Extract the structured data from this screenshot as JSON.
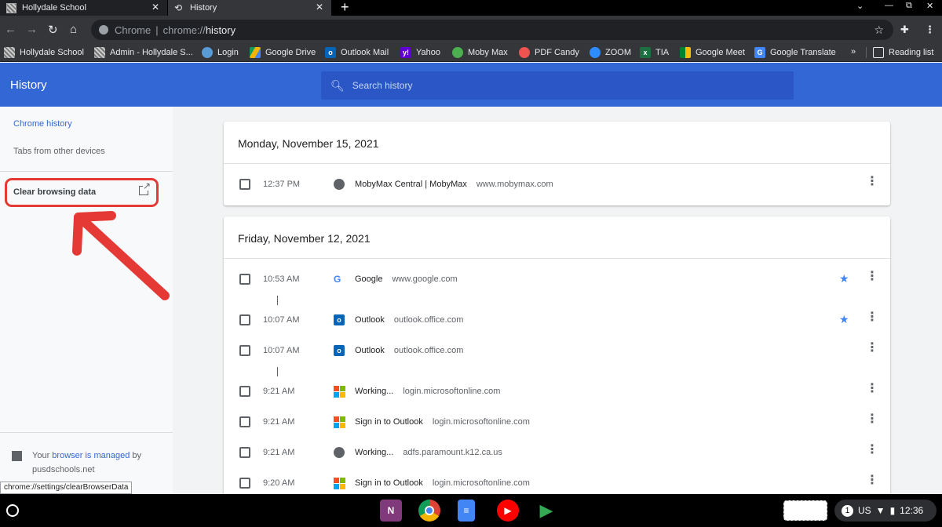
{
  "tabs": [
    {
      "title": "Hollydale School",
      "active": false
    },
    {
      "title": "History",
      "active": true
    }
  ],
  "omnibox": {
    "chip": "Chrome",
    "scheme": "chrome://",
    "path": "history"
  },
  "bookmarks": [
    {
      "label": "Hollydale School",
      "icon": "school-icon"
    },
    {
      "label": "Admin - Hollydale S...",
      "icon": "school-icon"
    },
    {
      "label": "Login",
      "icon": "cloud-icon"
    },
    {
      "label": "Google Drive",
      "icon": "drive-icon"
    },
    {
      "label": "Outlook Mail",
      "icon": "outlook-icon"
    },
    {
      "label": "Yahoo",
      "icon": "yahoo-icon"
    },
    {
      "label": "Moby Max",
      "icon": "mobymax-icon"
    },
    {
      "label": "PDF Candy",
      "icon": "pdfcandy-icon"
    },
    {
      "label": "ZOOM",
      "icon": "zoom-icon"
    },
    {
      "label": "TIA",
      "icon": "excel-icon"
    },
    {
      "label": "Google Meet",
      "icon": "meet-icon"
    },
    {
      "label": "Google Translate",
      "icon": "translate-icon"
    },
    {
      "label": "»",
      "icon": ""
    },
    {
      "label": "Reading list",
      "icon": "reading-list-icon"
    }
  ],
  "header": {
    "title": "History",
    "search_placeholder": "Search history"
  },
  "sidebar": {
    "chrome_history": "Chrome history",
    "tabs_other": "Tabs from other devices",
    "clear_browsing": "Clear browsing data",
    "managed_prefix": "Your",
    "managed_link": "browser is managed",
    "managed_suffix": "by",
    "managed_domain": "pusdschools.net"
  },
  "days": [
    {
      "date": "Monday, November 15, 2021",
      "entries": [
        {
          "time": "12:37 PM",
          "icon": "globe",
          "title": "MobyMax Central | MobyMax",
          "domain": "www.mobymax.com",
          "starred": false
        }
      ]
    },
    {
      "date": "Friday, November 12, 2021",
      "entries": [
        {
          "time": "10:53 AM",
          "icon": "google",
          "title": "Google",
          "domain": "www.google.com",
          "starred": true
        },
        {
          "time": "10:07 AM",
          "icon": "outlook",
          "title": "Outlook",
          "domain": "outlook.office.com",
          "starred": true
        },
        {
          "time": "10:07 AM",
          "icon": "outlook",
          "title": "Outlook",
          "domain": "outlook.office.com",
          "starred": false
        },
        {
          "time": "9:21 AM",
          "icon": "microsoft",
          "title": "Working...",
          "domain": "login.microsoftonline.com",
          "starred": false
        },
        {
          "time": "9:21 AM",
          "icon": "microsoft",
          "title": "Sign in to Outlook",
          "domain": "login.microsoftonline.com",
          "starred": false
        },
        {
          "time": "9:21 AM",
          "icon": "globe",
          "title": "Working...",
          "domain": "adfs.paramount.k12.ca.us",
          "starred": false
        },
        {
          "time": "9:20 AM",
          "icon": "microsoft",
          "title": "Sign in to Outlook",
          "domain": "login.microsoftonline.com",
          "starred": false
        }
      ]
    }
  ],
  "status_url": "chrome://settings/clearBrowserData",
  "shelf": {
    "apps": [
      "onenote-icon",
      "chrome-icon",
      "docs-icon",
      "youtube-icon",
      "play-store-icon"
    ],
    "tray_badge": "1",
    "tray_lang": "US",
    "clock": "12:36"
  },
  "colors": {
    "header_blue": "#3367d6",
    "annotation_red": "#e53935",
    "star_blue": "#4285f4"
  }
}
